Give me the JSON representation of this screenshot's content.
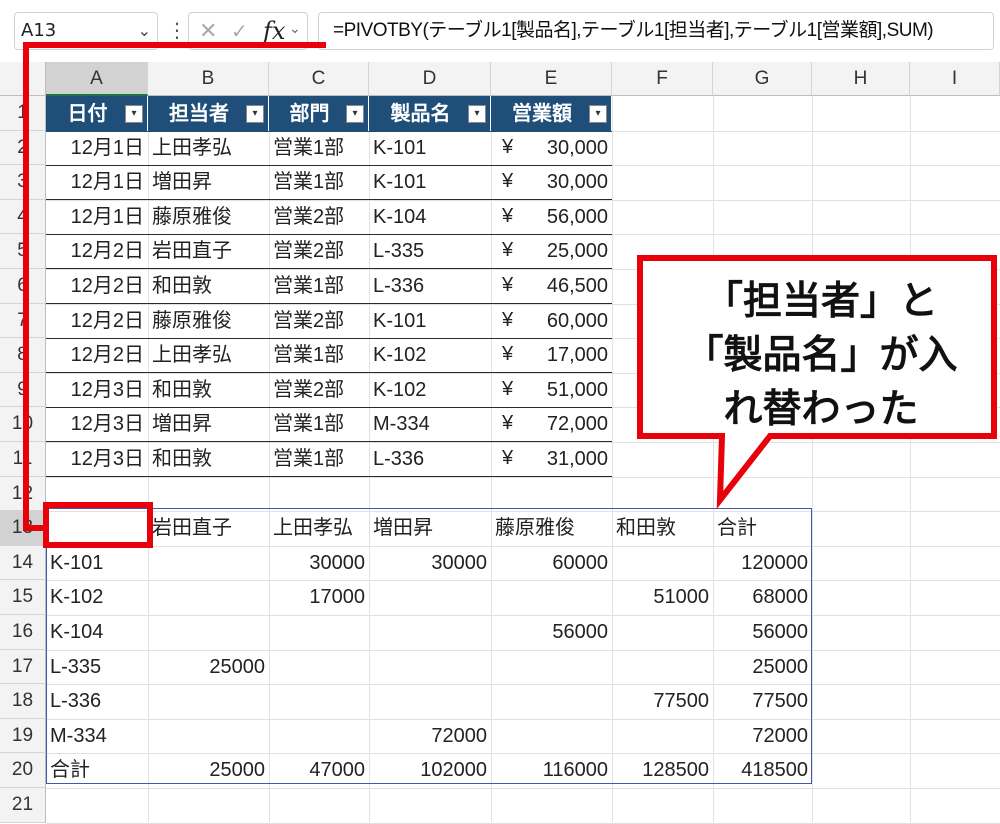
{
  "namebox": {
    "cell": "A13",
    "dropdown": "⌄"
  },
  "formula_bar": {
    "separator": "⋮",
    "cancel": "✕",
    "confirm": "✓",
    "fx": "fx",
    "fx_dropdown": "⌄",
    "formula": "=PIVOTBY(テーブル1[製品名],テーブル1[担当者],テーブル1[営業額],SUM)"
  },
  "columns": [
    "A",
    "B",
    "C",
    "D",
    "E",
    "F",
    "G",
    "H",
    "I"
  ],
  "rows": [
    "1",
    "2",
    "3",
    "4",
    "5",
    "6",
    "7",
    "8",
    "9",
    "10",
    "11",
    "12",
    "13",
    "14",
    "15",
    "16",
    "17",
    "18",
    "19",
    "20",
    "21"
  ],
  "table": {
    "headers": [
      "日付",
      "担当者",
      "部門",
      "製品名",
      "営業額"
    ],
    "filter_glyph": "▾",
    "currency": "¥",
    "rows": [
      [
        "12月1日",
        "上田孝弘",
        "営業1部",
        "K-101",
        "30,000"
      ],
      [
        "12月1日",
        "増田昇",
        "営業1部",
        "K-101",
        "30,000"
      ],
      [
        "12月1日",
        "藤原雅俊",
        "営業2部",
        "K-104",
        "56,000"
      ],
      [
        "12月2日",
        "岩田直子",
        "営業2部",
        "L-335",
        "25,000"
      ],
      [
        "12月2日",
        "和田敦",
        "営業1部",
        "L-336",
        "46,500"
      ],
      [
        "12月2日",
        "藤原雅俊",
        "営業2部",
        "K-101",
        "60,000"
      ],
      [
        "12月2日",
        "上田孝弘",
        "営業1部",
        "K-102",
        "17,000"
      ],
      [
        "12月3日",
        "和田敦",
        "営業2部",
        "K-102",
        "51,000"
      ],
      [
        "12月3日",
        "増田昇",
        "営業1部",
        "M-334",
        "72,000"
      ],
      [
        "12月3日",
        "和田敦",
        "営業1部",
        "L-336",
        "31,000"
      ]
    ]
  },
  "pivot": {
    "header": [
      "",
      "岩田直子",
      "上田孝弘",
      "増田昇",
      "藤原雅俊",
      "和田敦",
      "合計"
    ],
    "rows": [
      [
        "K-101",
        "",
        "30000",
        "30000",
        "60000",
        "",
        "120000"
      ],
      [
        "K-102",
        "",
        "17000",
        "",
        "",
        "51000",
        "68000"
      ],
      [
        "K-104",
        "",
        "",
        "",
        "56000",
        "",
        "56000"
      ],
      [
        "L-335",
        "25000",
        "",
        "",
        "",
        "",
        "25000"
      ],
      [
        "L-336",
        "",
        "",
        "",
        "",
        "77500",
        "77500"
      ],
      [
        "M-334",
        "",
        "",
        "72000",
        "",
        "",
        "72000"
      ],
      [
        "合計",
        "25000",
        "47000",
        "102000",
        "116000",
        "128500",
        "418500"
      ]
    ]
  },
  "callout": {
    "lines": [
      "「担当者」と",
      "「製品名」が入",
      "れ替わった"
    ]
  },
  "colors": {
    "annotation_red": "#e8000b",
    "table_header": "#1f4e79",
    "pivot_border": "#4059a8"
  }
}
